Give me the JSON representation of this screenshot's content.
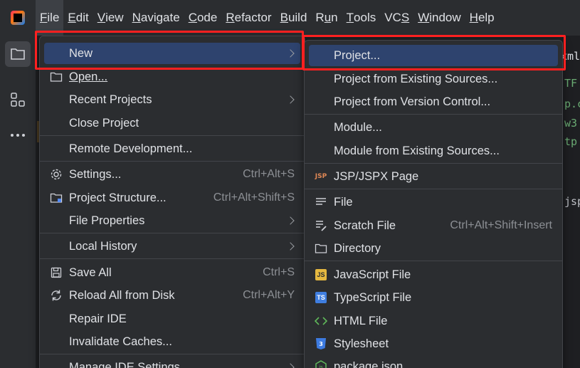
{
  "menubar": {
    "items": [
      {
        "label": "File",
        "mnemonic": "F",
        "rest": "ile",
        "active": true
      },
      {
        "label": "Edit",
        "mnemonic": "E",
        "rest": "dit"
      },
      {
        "label": "View",
        "mnemonic": "V",
        "rest": "iew"
      },
      {
        "label": "Navigate",
        "mnemonic": "N",
        "rest": "avigate"
      },
      {
        "label": "Code",
        "mnemonic": "C",
        "rest": "ode"
      },
      {
        "label": "Refactor",
        "mnemonic": "R",
        "rest": "efactor"
      },
      {
        "label": "Build",
        "mnemonic": "B",
        "rest": "uild"
      },
      {
        "label": "Run",
        "pre": "R",
        "mnemonic": "u",
        "rest": "n"
      },
      {
        "label": "Tools",
        "mnemonic": "T",
        "rest": "ools"
      },
      {
        "label": "VCS",
        "pre": "VC",
        "mnemonic": "S",
        "rest": ""
      },
      {
        "label": "Window",
        "mnemonic": "W",
        "rest": "indow"
      },
      {
        "label": "Help",
        "mnemonic": "H",
        "rest": "elp"
      }
    ]
  },
  "file_menu": {
    "new": "New",
    "open": "Open...",
    "recent_projects": "Recent Projects",
    "close_project": "Close Project",
    "remote_development": "Remote Development...",
    "settings": "Settings...",
    "settings_shortcut": "Ctrl+Alt+S",
    "project_structure": "Project Structure...",
    "project_structure_shortcut": "Ctrl+Alt+Shift+S",
    "file_properties": "File Properties",
    "local_history": "Local History",
    "save_all": "Save All",
    "save_all_shortcut": "Ctrl+S",
    "reload_all": "Reload All from Disk",
    "reload_all_shortcut": "Ctrl+Alt+Y",
    "repair_ide": "Repair IDE",
    "invalidate_caches": "Invalidate Caches...",
    "manage_ide_settings": "Manage IDE Settings"
  },
  "new_menu": {
    "project": "Project...",
    "project_existing": "Project from Existing Sources...",
    "project_vcs": "Project from Version Control...",
    "module": "Module...",
    "module_existing": "Module from Existing Sources...",
    "jsp_page": "JSP/JSPX Page",
    "file": "File",
    "scratch_file": "Scratch File",
    "scratch_shortcut": "Ctrl+Alt+Shift+Insert",
    "directory": "Directory",
    "javascript_file": "JavaScript File",
    "typescript_file": "TypeScript File",
    "html_file": "HTML File",
    "stylesheet": "Stylesheet",
    "package_json": "package.json"
  },
  "editor": {
    "tab_fragment": "xml",
    "lines": [
      "TF",
      "p.c",
      "w3",
      "tp",
      "jsp"
    ]
  },
  "colors": {
    "selection": "#2e436e",
    "highlight": "#ff2020",
    "background": "#2b2d30"
  }
}
